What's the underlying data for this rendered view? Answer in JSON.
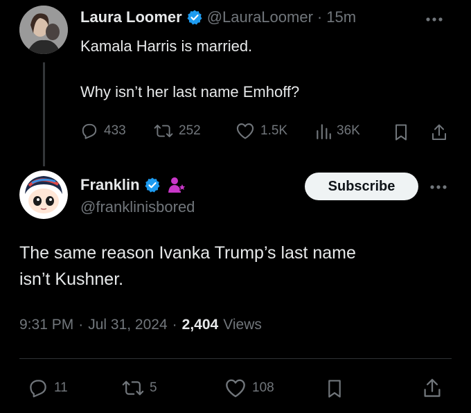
{
  "colors": {
    "accent": "#1d9bf0",
    "text": "#e7e9ea",
    "muted": "#71767b",
    "background": "#000000",
    "creator_badge": "#c837c8"
  },
  "parent_tweet": {
    "author_name": "Laura Loomer",
    "handle": "@LauraLoomer",
    "separator": "·",
    "time": "15m",
    "verified": true,
    "line1": "Kamala Harris is married.",
    "line2": "Why isn’t her last name Emhoff?",
    "stats": {
      "replies": "433",
      "retweets": "252",
      "likes": "1.5K",
      "views": "36K"
    },
    "icons": [
      "reply-icon",
      "retweet-icon",
      "like-icon",
      "views-icon",
      "bookmark-icon",
      "share-icon",
      "more-icon"
    ]
  },
  "main_tweet": {
    "author_name": "Franklin",
    "handle": "@franklinisbored",
    "verified": true,
    "subscribe_label": "Subscribe",
    "line1": "The same reason Ivanka Trump’s last name",
    "line2": "isn’t Kushner.",
    "time": "9:31 PM",
    "sep1": "·",
    "date": "Jul 31, 2024",
    "sep2": "·",
    "views_count": "2,404",
    "views_label": "Views",
    "stats": {
      "replies": "11",
      "retweets": "5",
      "likes": "108"
    },
    "icons": [
      "reply-icon",
      "retweet-icon",
      "like-icon",
      "bookmark-icon",
      "share-icon",
      "more-icon",
      "creator-badge-icon"
    ]
  }
}
